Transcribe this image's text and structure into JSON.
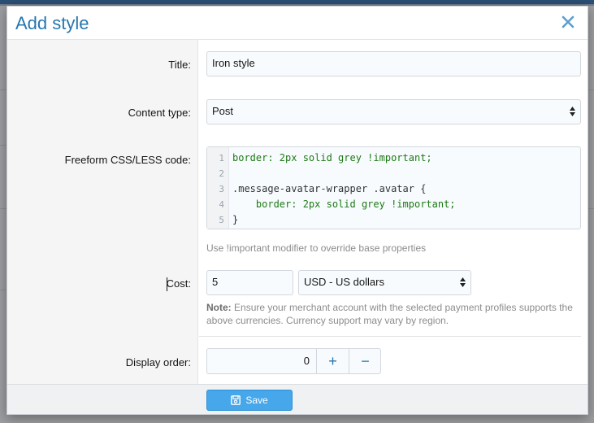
{
  "dialog": {
    "title": "Add style",
    "close_icon": "close-icon"
  },
  "form": {
    "title": {
      "label": "Title:",
      "value": "Iron style"
    },
    "content_type": {
      "label": "Content type:",
      "value": "Post"
    },
    "css": {
      "label": "Freeform CSS/LESS code:",
      "line_numbers": [
        "1",
        "2",
        "3",
        "4",
        "5"
      ],
      "lines": [
        "border: 2px solid grey !important;",
        "",
        ".message-avatar-wrapper .avatar {",
        "    border: 2px solid grey !important;",
        "}"
      ],
      "hint": "Use !important modifier to override base properties"
    },
    "cost": {
      "label": "Cost:",
      "value": "5",
      "currency": "USD - US dollars",
      "note_label": "Note:",
      "note_text": "Ensure your merchant account with the selected payment profiles supports the",
      "note_text_2": "above currencies. Currency support may vary by region."
    },
    "display_order": {
      "label": "Display order:",
      "value": "0",
      "plus": "+",
      "minus": "−"
    }
  },
  "footer": {
    "save_label": "Save",
    "save_icon": "save-icon"
  },
  "colors": {
    "accent": "#2577b1",
    "button": "#47a7eb"
  }
}
